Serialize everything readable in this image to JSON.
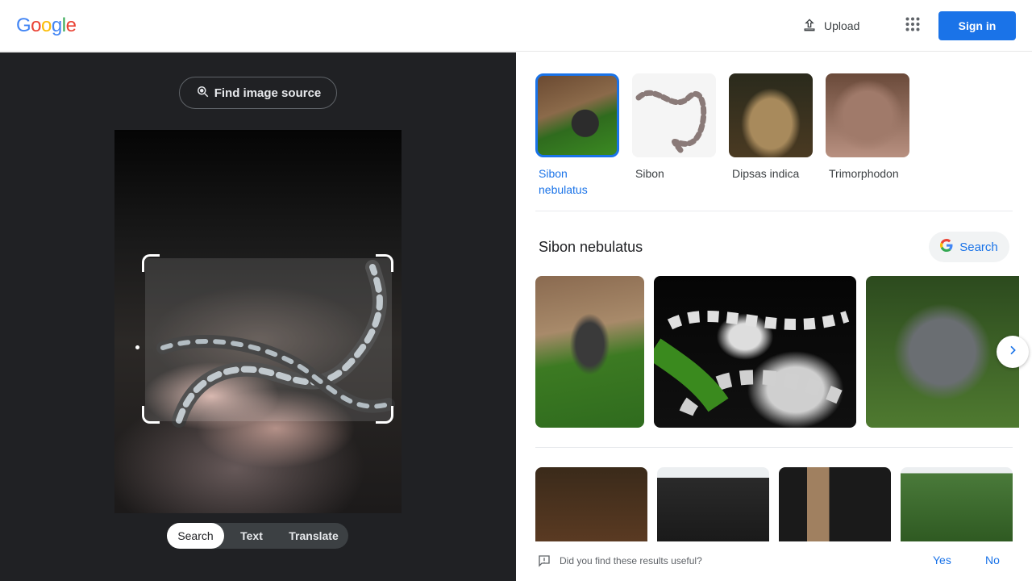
{
  "header": {
    "logo_letters": [
      {
        "char": "G",
        "color": "#4285F4"
      },
      {
        "char": "o",
        "color": "#EA4335"
      },
      {
        "char": "o",
        "color": "#FBBC05"
      },
      {
        "char": "g",
        "color": "#4285F4"
      },
      {
        "char": "l",
        "color": "#34A853"
      },
      {
        "char": "e",
        "color": "#EA4335"
      }
    ],
    "upload_label": "Upload",
    "upload_icon": "upload-icon",
    "apps_icon": "apps-grid-icon",
    "signin_label": "Sign in"
  },
  "left": {
    "find_source_label": "Find image source",
    "modes": [
      "Search",
      "Text",
      "Translate"
    ],
    "active_mode": "Search"
  },
  "right": {
    "related": [
      {
        "label": "Sibon nebulatus",
        "selected": true
      },
      {
        "label": "Sibon",
        "selected": false
      },
      {
        "label": "Dipsas indica",
        "selected": false
      },
      {
        "label": "Trimorphodon",
        "selected": false
      }
    ],
    "section_title": "Sibon nebulatus",
    "search_chip_label": "Search",
    "results_row1_count": 3,
    "results_row2_count": 4,
    "feedback": {
      "question": "Did you find these results useful?",
      "yes": "Yes",
      "no": "No"
    }
  },
  "colors": {
    "accent": "#1a73e8",
    "dark_panel": "#202124"
  }
}
